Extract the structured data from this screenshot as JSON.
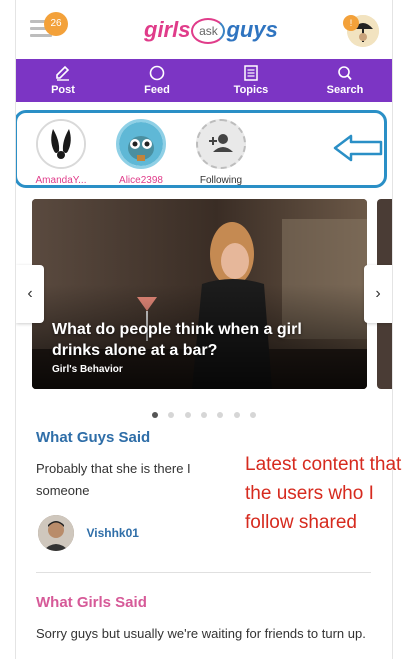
{
  "header": {
    "notification_count": "26",
    "logo": {
      "girls": "girls",
      "ask": "ask",
      "guys": "guys"
    },
    "profile_badge": "!"
  },
  "nav": {
    "items": [
      {
        "label": "Post",
        "icon": "pencil-icon"
      },
      {
        "label": "Feed",
        "icon": "feed-icon"
      },
      {
        "label": "Topics",
        "icon": "topics-icon"
      },
      {
        "label": "Search",
        "icon": "search-icon"
      }
    ],
    "background": "#7c35c4"
  },
  "stories": {
    "items": [
      {
        "name": "AmandaY...",
        "color": "#e03c8a"
      },
      {
        "name": "Alice2398",
        "color": "#e03c8a"
      },
      {
        "name": "Following",
        "color": "#333333"
      }
    ]
  },
  "carousel": {
    "title": "What do people think when a girl drinks alone at a bar?",
    "category": "Girl's Behavior",
    "prev": "‹",
    "next": "›",
    "slide_count": 7,
    "active_index": 0
  },
  "answers": {
    "guys_title": "What Guys Said",
    "guys_text": "Probably that she is there I someone",
    "guys_user": "Vishhk01",
    "girls_title": "What Girls Said",
    "girls_text": "Sorry guys but usually we're waiting for friends to turn up."
  },
  "annotation": {
    "text": "Latest content that the users who I follow shared",
    "color": "#d62a1e"
  }
}
